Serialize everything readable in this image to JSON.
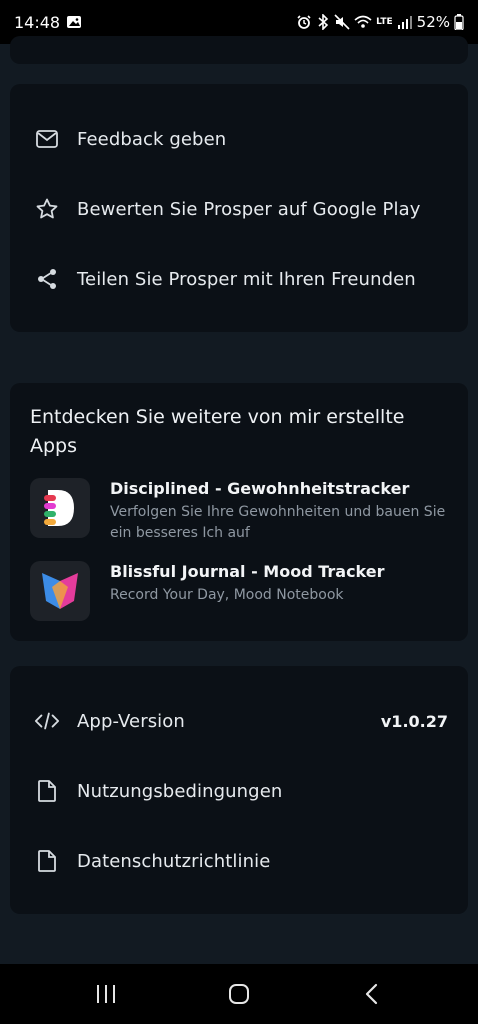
{
  "status_bar": {
    "time": "14:48",
    "lte_label": "LTE",
    "battery_percent": "52%"
  },
  "links_card": {
    "items": [
      {
        "label": "Feedback geben",
        "icon": "mail-icon"
      },
      {
        "label": "Bewerten Sie Prosper auf Google Play",
        "icon": "star-icon"
      },
      {
        "label": "Teilen Sie Prosper mit Ihren Freunden",
        "icon": "share-icon"
      }
    ]
  },
  "apps_card": {
    "title": "Entdecken Sie weitere von mir erstellte Apps",
    "apps": [
      {
        "name": "Disciplined - Gewohnheitstracker",
        "description": "Verfolgen Sie Ihre Gewohnheiten und bauen Sie ein besseres Ich auf"
      },
      {
        "name": "Blissful Journal - Mood Tracker",
        "description": "Record Your Day, Mood Notebook"
      }
    ]
  },
  "info_card": {
    "version_label": "App-Version",
    "version_value": "v1.0.27",
    "terms_label": "Nutzungsbedingungen",
    "privacy_label": "Datenschutzrichtlinie"
  },
  "colors": {
    "background": "#121a22",
    "card": "#0b1016",
    "text": "#e6eaee",
    "muted": "#8f98a2"
  }
}
